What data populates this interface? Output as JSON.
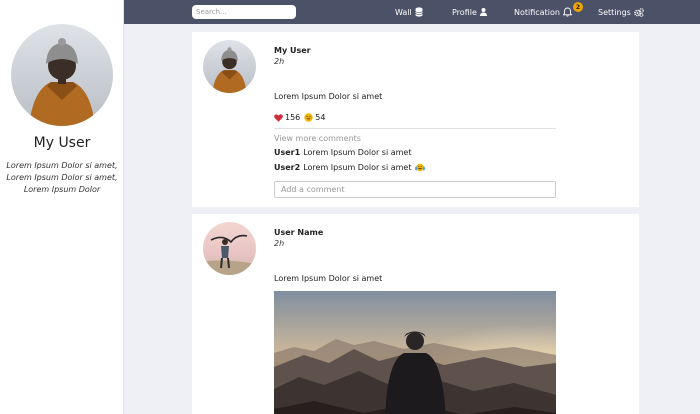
{
  "sidebar": {
    "user_name": "My User",
    "bio": "Lorem Ipsum Dolor si amet, Lorem Ipsum Dolor si amet, Lorem Ipsum Dolor"
  },
  "topbar": {
    "search_placeholder": "Search...",
    "nav": {
      "wall": "Wall",
      "profile": "Profile",
      "notification": "Notification",
      "notification_count": "2",
      "settings": "Settings"
    }
  },
  "posts": [
    {
      "author": "My User",
      "time": "2h",
      "text": "Lorem Ipsum Dolor si amet",
      "hearts": "156",
      "smiles": "54",
      "view_more": "View more comments",
      "comments": [
        {
          "user": "User1",
          "text": "Lorem Ipsum Dolor si amet"
        },
        {
          "user": "User2",
          "text": "Lorem Ipsum Dolor si amet"
        }
      ],
      "comment_placeholder": "Add a comment"
    },
    {
      "author": "User Name",
      "time": "2h",
      "text": "Lorem Ipsum Dolor si amet"
    }
  ],
  "colors": {
    "topbar": "#4b5166",
    "background": "#eef0f5",
    "badge": "#f0a500",
    "heart": "#d42a3a"
  }
}
